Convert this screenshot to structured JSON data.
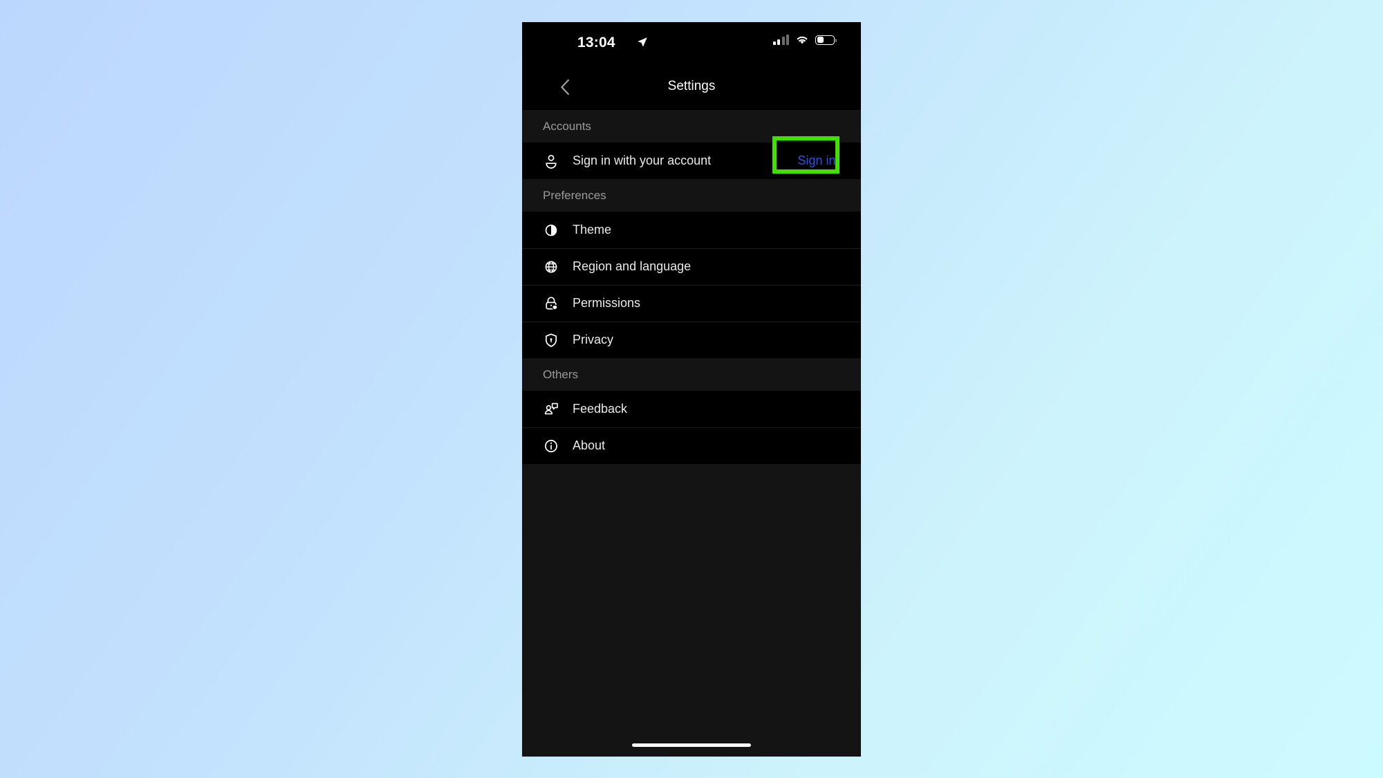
{
  "status_bar": {
    "time": "13:04",
    "location_icon": "location-arrow-icon",
    "signal_icon": "cellular-signal-icon",
    "signal_bars_filled": 2,
    "signal_bars_total": 4,
    "wifi_icon": "wifi-icon",
    "battery_icon": "battery-low-icon"
  },
  "nav": {
    "back_icon": "chevron-left-icon",
    "title": "Settings"
  },
  "sections": [
    {
      "header": "Accounts",
      "rows": [
        {
          "icon": "person-icon",
          "label": "Sign in with your account",
          "action": "Sign in",
          "highlighted": true
        }
      ]
    },
    {
      "header": "Preferences",
      "rows": [
        {
          "icon": "contrast-icon",
          "label": "Theme"
        },
        {
          "icon": "globe-icon",
          "label": "Region and language"
        },
        {
          "icon": "lock-shield-icon",
          "label": "Permissions"
        },
        {
          "icon": "shield-keyhole-icon",
          "label": "Privacy"
        }
      ]
    },
    {
      "header": "Others",
      "rows": [
        {
          "icon": "feedback-icon",
          "label": "Feedback"
        },
        {
          "icon": "info-circle-icon",
          "label": "About"
        }
      ]
    }
  ],
  "colors": {
    "accent_link": "#3050e8",
    "highlight": "#42e000",
    "row_bg": "#000000",
    "section_bg": "#141414"
  },
  "home_indicator": "home-indicator"
}
